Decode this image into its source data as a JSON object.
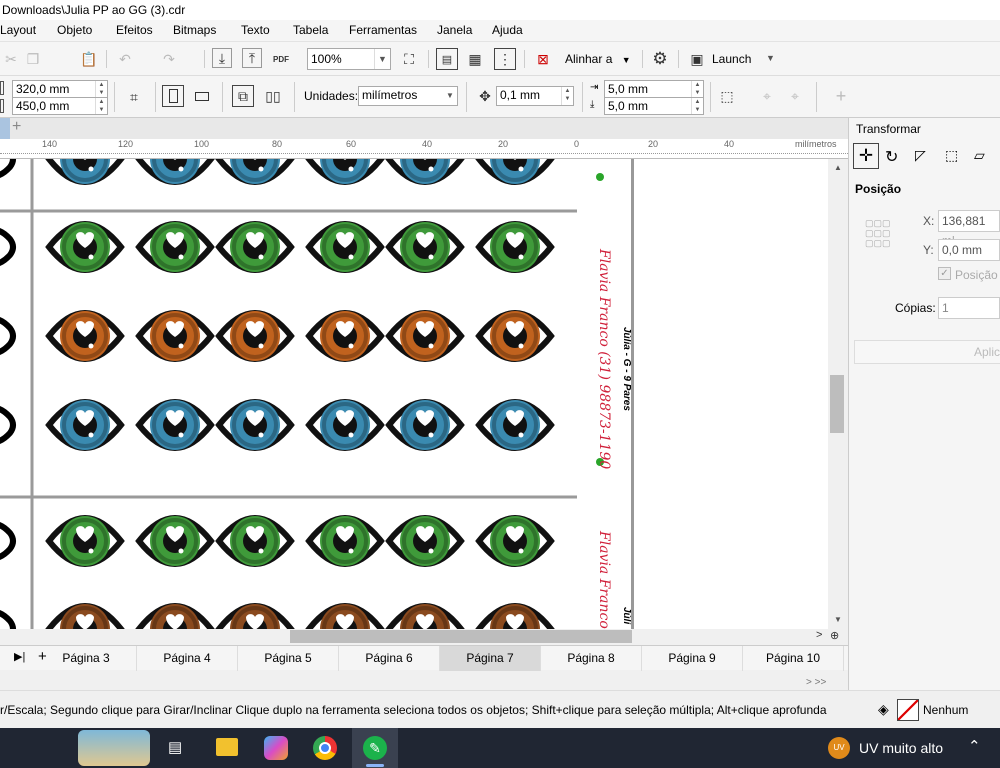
{
  "window": {
    "title": "Downloads\\Julia PP ao GG (3).cdr"
  },
  "menu": {
    "items": [
      "Layout",
      "Objeto",
      "Efeitos",
      "Bitmaps",
      "Texto",
      "Tabela",
      "Ferramentas",
      "Janela",
      "Ajuda"
    ]
  },
  "toolbar": {
    "zoom": "100%",
    "align_label": "Alinhar a",
    "launch_label": "Launch"
  },
  "propbar": {
    "width": "320,0 mm",
    "height": "450,0 mm",
    "units_label": "Unidades:",
    "units_value": "milímetros",
    "nudge": "0,1 mm",
    "dup_x": "5,0 mm",
    "dup_y": "5,0 mm"
  },
  "ruler": {
    "ticks": [
      "140",
      "120",
      "100",
      "80",
      "60",
      "40",
      "20",
      "0",
      "20",
      "40"
    ],
    "unit": "milímetros"
  },
  "canvas": {
    "vertical_text_1": "Flavia Franco (31) 98873-1190",
    "vertical_text_2": "Júlia - G - 9 Pares",
    "vertical_text_3": "Flavia Franco (",
    "vertical_text_4": "Júli",
    "eye_rows": [
      {
        "iris": [
          "#3a8ab0",
          "#3a8ab0",
          "#3a8ab0",
          "#3a8ab0",
          "#3a8ab0",
          "#3a8ab0"
        ]
      },
      {
        "iris": [
          "#3f9a3a",
          "#3f9a3a",
          "#3f9a3a",
          "#3f9a3a",
          "#3f9a3a",
          "#3f9a3a"
        ]
      },
      {
        "iris": [
          "#c0621e",
          "#c0621e",
          "#c0621e",
          "#c0621e",
          "#c0621e",
          "#c0621e"
        ]
      },
      {
        "iris": [
          "#3a8ab0",
          "#3a8ab0",
          "#3a8ab0",
          "#3a8ab0",
          "#3a8ab0",
          "#3a8ab0"
        ]
      },
      {
        "iris": [
          "#3f9a3a",
          "#3f9a3a",
          "#3f9a3a",
          "#3f9a3a",
          "#3f9a3a",
          "#3f9a3a"
        ]
      },
      {
        "iris": [
          "#8a4a1e",
          "#8a4a1e",
          "#8a4a1e",
          "#8a4a1e",
          "#8a4a1e",
          "#8a4a1e"
        ]
      }
    ]
  },
  "pages": [
    "Página 3",
    "Página 4",
    "Página 5",
    "Página 6",
    "Página 7",
    "Página 8",
    "Página 9",
    "Página 10"
  ],
  "active_page": "Página 7",
  "docker": {
    "title": "Transformar",
    "section": "Posição",
    "x_label": "X:",
    "x_value": "136,881 mi",
    "y_label": "Y:",
    "y_value": "0,0 mm",
    "relative_label": "Posição r",
    "copies_label": "Cópias:",
    "copies_value": "1",
    "apply_label": "Aplic"
  },
  "status": {
    "hint": "r/Escala; Segundo clique para Girar/Inclinar Clique duplo na ferramenta seleciona todos os objetos; Shift+clique para seleção múltipla; Alt+clique aprofunda",
    "fill_label": "Nenhum"
  },
  "taskbar": {
    "uv_badge": "UV",
    "uv_label": "UV muito alto"
  }
}
